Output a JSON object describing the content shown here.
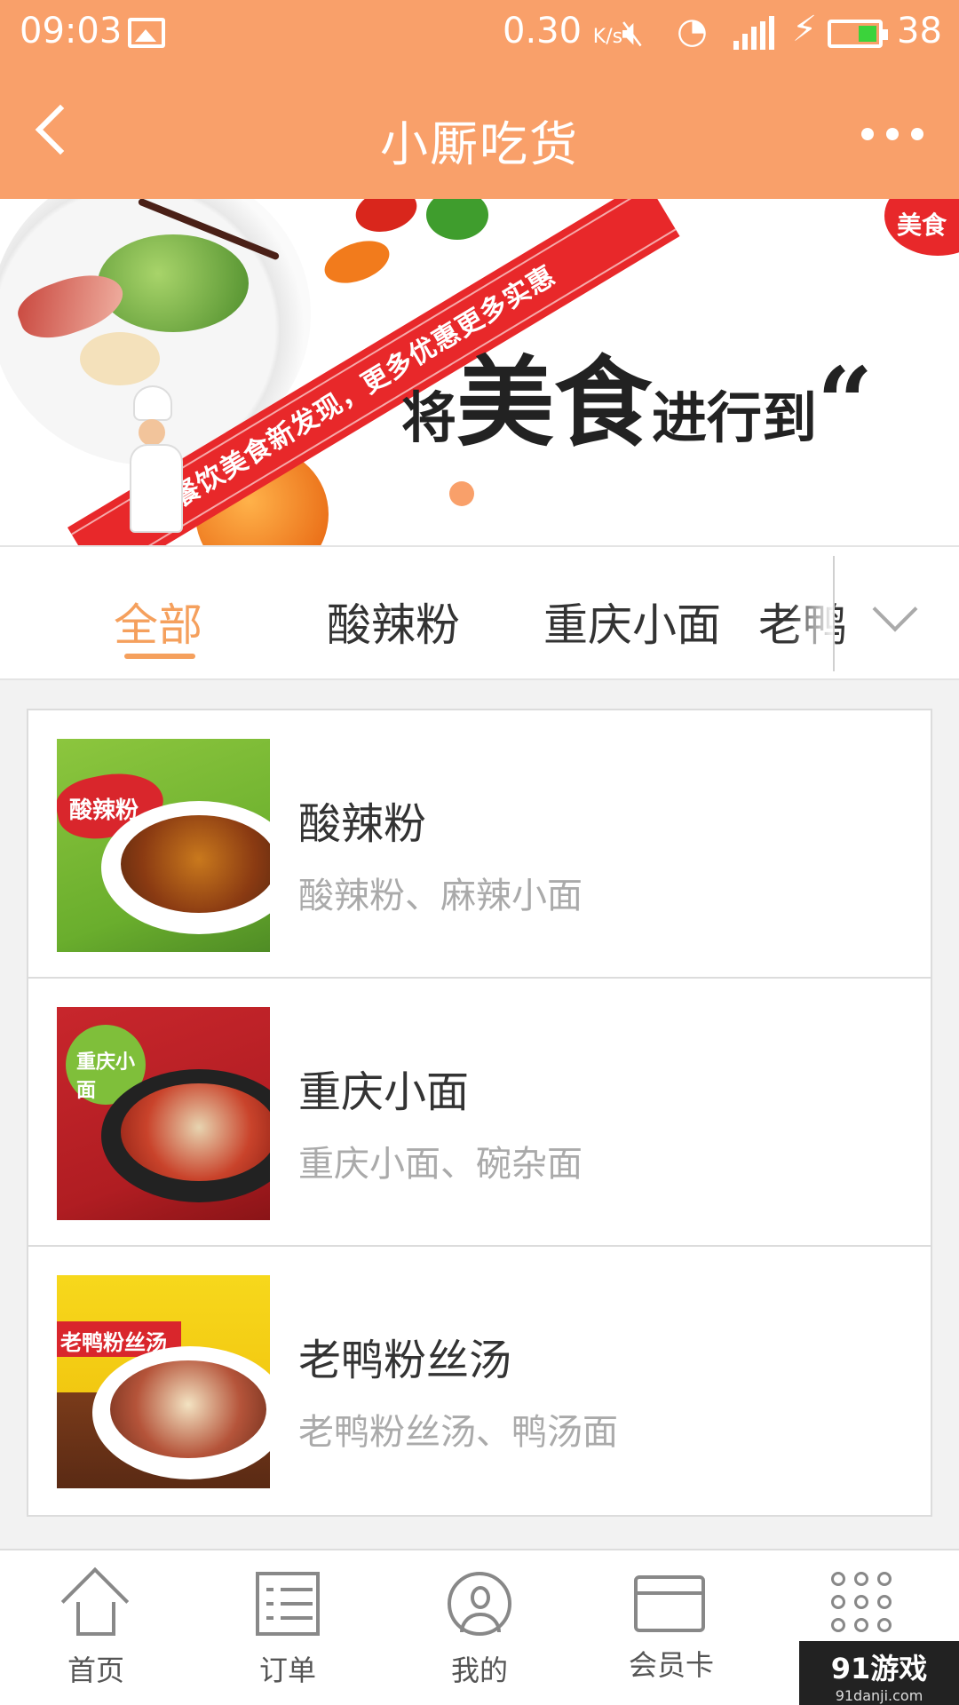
{
  "status_bar": {
    "time": "09:03",
    "network_speed": "0.30",
    "network_speed_unit": "K/s",
    "network_type": "4G",
    "battery_level": "38"
  },
  "header": {
    "title": "小厮吃货"
  },
  "banner": {
    "ribbon_text": "餐饮美食新发现，更多优惠更多实惠",
    "slogan_small_1": "将",
    "slogan_big": "美食",
    "slogan_small_2": "进行到",
    "slogan_quote": "“",
    "slogan_cut": "​",
    "badge": "美食"
  },
  "tabs": {
    "items": [
      "全部",
      "酸辣粉",
      "重庆小面",
      "老鸭粉丝汤"
    ],
    "active_index": 0,
    "visible_partial": "老鸭"
  },
  "list": [
    {
      "title": "酸辣粉",
      "subtitle": "酸辣粉、麻辣小面",
      "thumb_tag": "酸辣粉"
    },
    {
      "title": "重庆小面",
      "subtitle": "重庆小面、碗杂面",
      "thumb_tag": "重庆小面"
    },
    {
      "title": "老鸭粉丝汤",
      "subtitle": "老鸭粉丝汤、鸭汤面",
      "thumb_tag": "老鸭粉丝汤"
    }
  ],
  "bottom_nav": {
    "home": "首页",
    "orders": "订单",
    "mine": "我的",
    "member_card": "会员卡",
    "more": "更多"
  },
  "watermark": {
    "brand": "91游戏",
    "url": "91danji.com"
  },
  "colors": {
    "header": "#f9a06a",
    "accent": "#f5a05d",
    "ribbon": "#e8282a"
  }
}
